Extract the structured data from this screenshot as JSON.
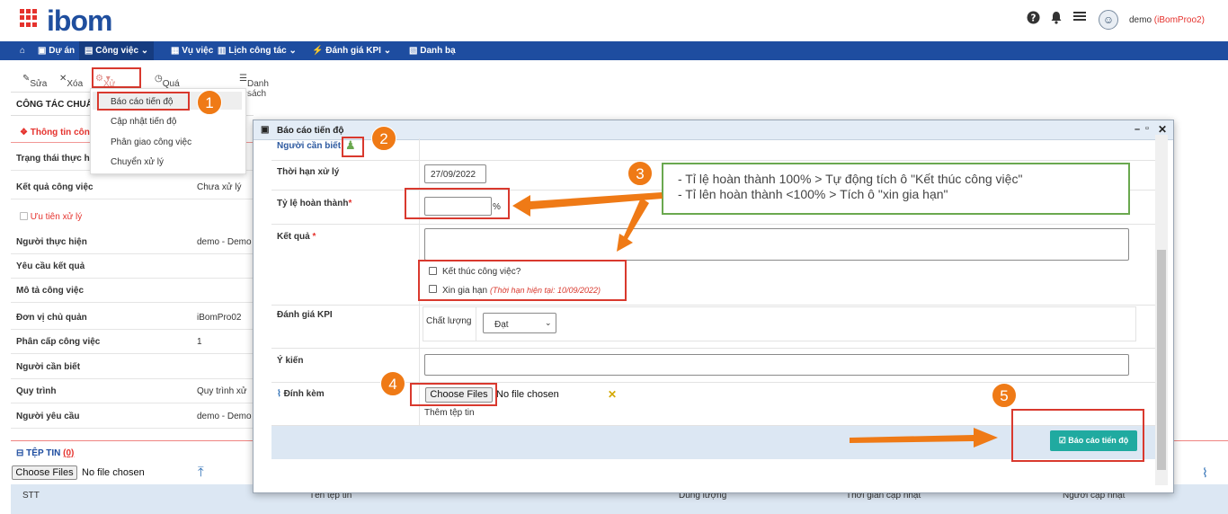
{
  "header": {
    "logo": "ibom",
    "user_name": "demo",
    "user_company": "(iBomProo2)"
  },
  "nav": {
    "items": [
      "Dự án",
      "Công việc",
      "Vụ việc",
      "Lịch công tác",
      "Đánh giá KPI",
      "Danh bạ"
    ]
  },
  "toolbar": {
    "edit": "Sửa",
    "delete": "Xóa",
    "process": "Xử lý",
    "history": "Quá trình xử lý",
    "list": "Danh sách"
  },
  "dropdown": {
    "items": [
      "Báo cáo tiến độ",
      "Cập nhật tiến độ",
      "Phân giao công việc",
      "Chuyển xử lý"
    ]
  },
  "left_panel": {
    "title": "CÔNG TÁC CHUẨ",
    "info_tab": "Thông tin côn",
    "priority": "Ưu tiên xử lý",
    "rows": [
      {
        "label": "Trạng thái thực h",
        "value": ""
      },
      {
        "label": "Kết quả công việc",
        "value": "Chưa xử lý"
      },
      {
        "label": "Người thực hiện",
        "value": "demo - Demo"
      },
      {
        "label": "Yêu cầu kết quả",
        "value": ""
      },
      {
        "label": "Mô tả công việc",
        "value": ""
      },
      {
        "label": "Đơn vị chủ quản",
        "value": "iBomPro02"
      },
      {
        "label": "Phân cấp công việc",
        "value": "1"
      },
      {
        "label": "Người cần biết",
        "value": ""
      },
      {
        "label": "Quy trình",
        "value": "Quy trình xử"
      },
      {
        "label": "Người yêu cầu",
        "value": "demo - Demo"
      }
    ]
  },
  "files": {
    "title": "TỆP TIN",
    "count": "(0)",
    "choose": "Choose Files",
    "none": "No file chosen",
    "columns": [
      "STT",
      "Tên tệp tin",
      "Dung lượng",
      "Thời gian cập nhật",
      "Người cập nhật"
    ]
  },
  "dialog": {
    "title": "Báo cáo tiến độ",
    "people_label": "Người cần biết",
    "deadline_label": "Thời hạn xử lý",
    "deadline_value": "27/09/2022",
    "rate_label": "Tỷ lệ hoàn thành",
    "rate_unit": "%",
    "result_label": "Kết quả",
    "finish_check": "Kết thúc công việc?",
    "extend_check": "Xin gia hạn",
    "extend_note": "(Thời hạn hiện tại: 10/09/2022)",
    "kpi_label": "Đánh giá KPI",
    "quality_label": "Chất lượng",
    "quality_value": "Đạt",
    "opinion_label": "Ý kiến",
    "attach_label": "Đính kèm",
    "choose": "Choose Files",
    "none": "No file chosen",
    "add_file": "Thêm tệp tin",
    "submit": "Báo cáo tiến độ"
  },
  "annotation": {
    "line1": "- Tỉ lệ hoàn thành 100% > Tự động tích ô \"Kết thúc công việc\"",
    "line2": "- Tỉ lên hoàn thành <100% > Tích ô \"xin gia hạn\"",
    "steps": [
      "1",
      "2",
      "3",
      "4",
      "5"
    ]
  }
}
